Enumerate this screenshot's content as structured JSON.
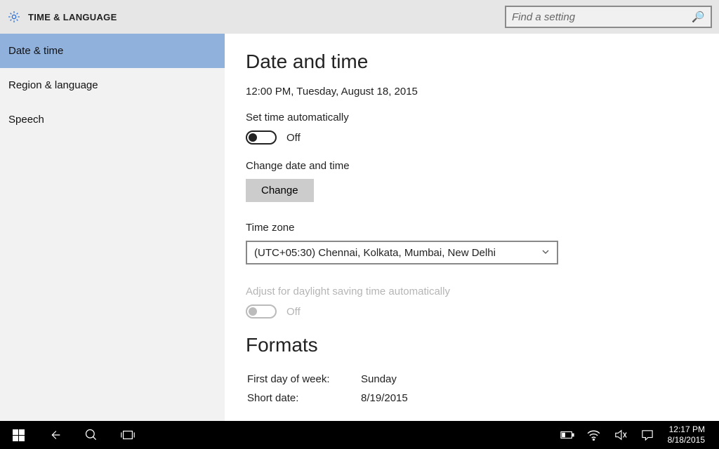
{
  "header": {
    "title": "TIME & LANGUAGE",
    "search_placeholder": "Find a setting"
  },
  "sidebar": {
    "items": [
      {
        "label": "Date & time",
        "active": true
      },
      {
        "label": "Region & language",
        "active": false
      },
      {
        "label": "Speech",
        "active": false
      }
    ]
  },
  "main": {
    "heading": "Date and time",
    "current_datetime": "12:00 PM, Tuesday, August 18, 2015",
    "set_time_auto_label": "Set time automatically",
    "set_time_auto_state": "Off",
    "change_section_label": "Change date and time",
    "change_button": "Change",
    "timezone_label": "Time zone",
    "timezone_value": "(UTC+05:30) Chennai, Kolkata, Mumbai, New Delhi",
    "dst_label": "Adjust for daylight saving time automatically",
    "dst_state": "Off",
    "formats_heading": "Formats",
    "formats": {
      "first_day_label": "First day of week:",
      "first_day_value": "Sunday",
      "short_date_label": "Short date:",
      "short_date_value": "8/19/2015"
    }
  },
  "taskbar": {
    "clock_time": "12:17 PM",
    "clock_date": "8/18/2015"
  }
}
